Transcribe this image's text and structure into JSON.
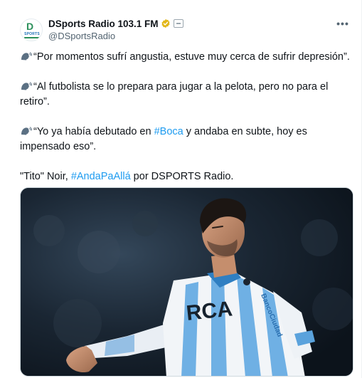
{
  "account": {
    "display_name": "DSports Radio 103.1 FM",
    "handle": "@DSportsRadio",
    "avatar_logo_letter": "D",
    "avatar_logo_text": "SPORTS",
    "verified": true,
    "verified_color": "#e2b719",
    "icon_names": [
      "verified-badge-icon",
      "affiliate-icon",
      "more-icon",
      "speaking-head-icon"
    ]
  },
  "tweet": {
    "quote1": "“Por momentos sufrí angustia, estuve muy cerca de sufrir depresión”.",
    "quote2": "“Al futbolista se lo prepara para jugar a la pelota, pero no para el retiro”.",
    "quote3_before": "“Yo ya había debutado en ",
    "quote3_hashtag": "#Boca",
    "quote3_after": " y andaba en subte, hoy es impensado eso”.",
    "closing_before": "\"Tito\" Noir, ",
    "closing_hashtag": "#AndaPaAllá",
    "closing_after": " por DSPORTS Radio.",
    "hashtag_color": "#1d9bf0"
  },
  "media": {
    "jersey_text": "RCA",
    "sponsor_text": "BancoCiudad",
    "kit_brand": "Kappa"
  }
}
